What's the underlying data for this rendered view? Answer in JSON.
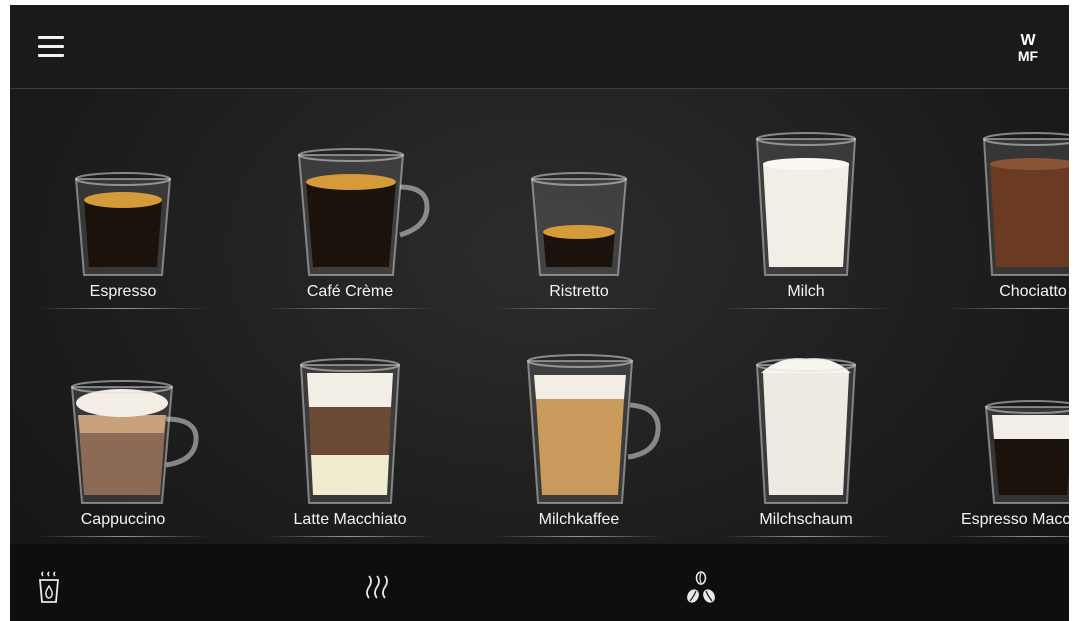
{
  "header": {
    "menu_icon": "hamburger-menu-icon",
    "logo_text_top": "W",
    "logo_text_bottom": "MF"
  },
  "drinks_row1": [
    {
      "label": "Espresso",
      "drink": "espresso"
    },
    {
      "label": "Café Crème",
      "drink": "cafe-creme"
    },
    {
      "label": "Ristretto",
      "drink": "ristretto"
    },
    {
      "label": "Milch",
      "drink": "milch"
    },
    {
      "label": "Chociatto",
      "drink": "chociatto"
    }
  ],
  "drinks_row2": [
    {
      "label": "Cappuccino",
      "drink": "cappuccino"
    },
    {
      "label": "Latte Macchiato",
      "drink": "latte-macchiato"
    },
    {
      "label": "Milchkaffee",
      "drink": "milchkaffee"
    },
    {
      "label": "Milchschaum",
      "drink": "milchschaum"
    },
    {
      "label": "Espresso Macchiato",
      "drink": "espresso-macchiato"
    }
  ],
  "bottom_bar": {
    "icons": [
      "hot-water-cup-icon",
      "steam-icon",
      "coffee-beans-icon"
    ]
  },
  "colors": {
    "background": "#1e1e1e",
    "text": "#f4f4f4",
    "coffee_dark": "#1c120c",
    "crema": "#d59a3a",
    "milk": "#f2eee6",
    "chocolate": "#6a3a22"
  }
}
